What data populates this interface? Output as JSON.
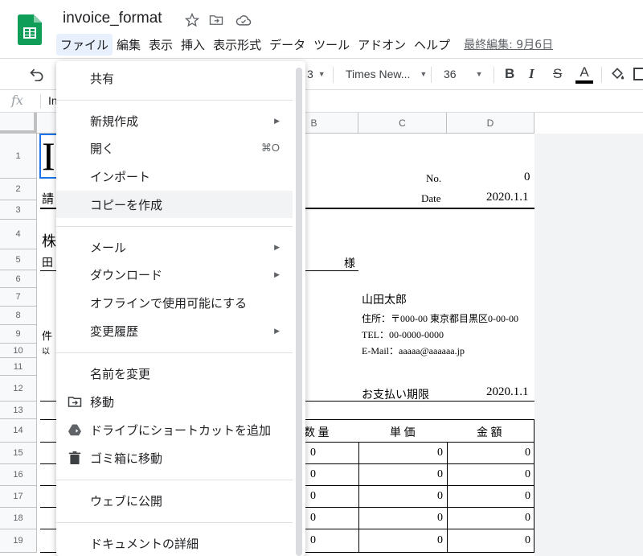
{
  "header": {
    "title": "invoice_format",
    "menus": [
      "ファイル",
      "編集",
      "表示",
      "挿入",
      "表示形式",
      "データ",
      "ツール",
      "アドオン",
      "ヘルプ"
    ],
    "last_edit": "最終編集: 9月6日"
  },
  "toolbar": {
    "zoom_fragment": "3",
    "font": "Times New...",
    "font_size": "36",
    "bold": "B",
    "italic": "I",
    "strike": "S",
    "text_color": "A"
  },
  "formula_bar": {
    "fx": "fx",
    "text": "In"
  },
  "grid": {
    "columns": [
      "B",
      "C",
      "D"
    ],
    "rows": [
      "1",
      "2",
      "3",
      "4",
      "5",
      "6",
      "7",
      "8",
      "9",
      "10",
      "11",
      "12",
      "13",
      "14",
      "15",
      "16",
      "17",
      "18",
      "19"
    ],
    "left_fragments": [
      "I",
      "請",
      "株",
      "田",
      "件",
      "以"
    ],
    "no_label": "No.",
    "no_value": "0",
    "date_label": "Date",
    "date_value": "2020.1.1",
    "sama": "様",
    "issuer": {
      "name": "山田太郎",
      "address": "住所：〒000-00 東京都目黒区0-00-00",
      "tel": "TEL：00-0000-0000",
      "email": "E-Mail：aaaaa@aaaaaa.jp"
    },
    "due_label": "お支払い期限",
    "due_value": "2020.1.1",
    "table_headers": [
      "数 量",
      "単 価",
      "金 額"
    ],
    "table_rows": [
      [
        "0",
        "0",
        "0"
      ],
      [
        "0",
        "0",
        "0"
      ],
      [
        "0",
        "0",
        "0"
      ],
      [
        "0",
        "0",
        "0"
      ],
      [
        "0",
        "0",
        "0"
      ]
    ]
  },
  "file_menu": {
    "share": "共有",
    "new": "新規作成",
    "open": "開く",
    "open_shortcut": "⌘O",
    "import": "インポート",
    "copy": "コピーを作成",
    "email": "メール",
    "download": "ダウンロード",
    "offline": "オフラインで使用可能にする",
    "history": "変更履歴",
    "rename": "名前を変更",
    "move": "移動",
    "shortcut": "ドライブにショートカットを追加",
    "trash": "ゴミ箱に移動",
    "publish": "ウェブに公開",
    "details": "ドキュメントの詳細"
  },
  "colors": {
    "sheets_green": "#0f9d58",
    "menu_active": "#e8f0fe",
    "hover": "#f1f3f4"
  }
}
